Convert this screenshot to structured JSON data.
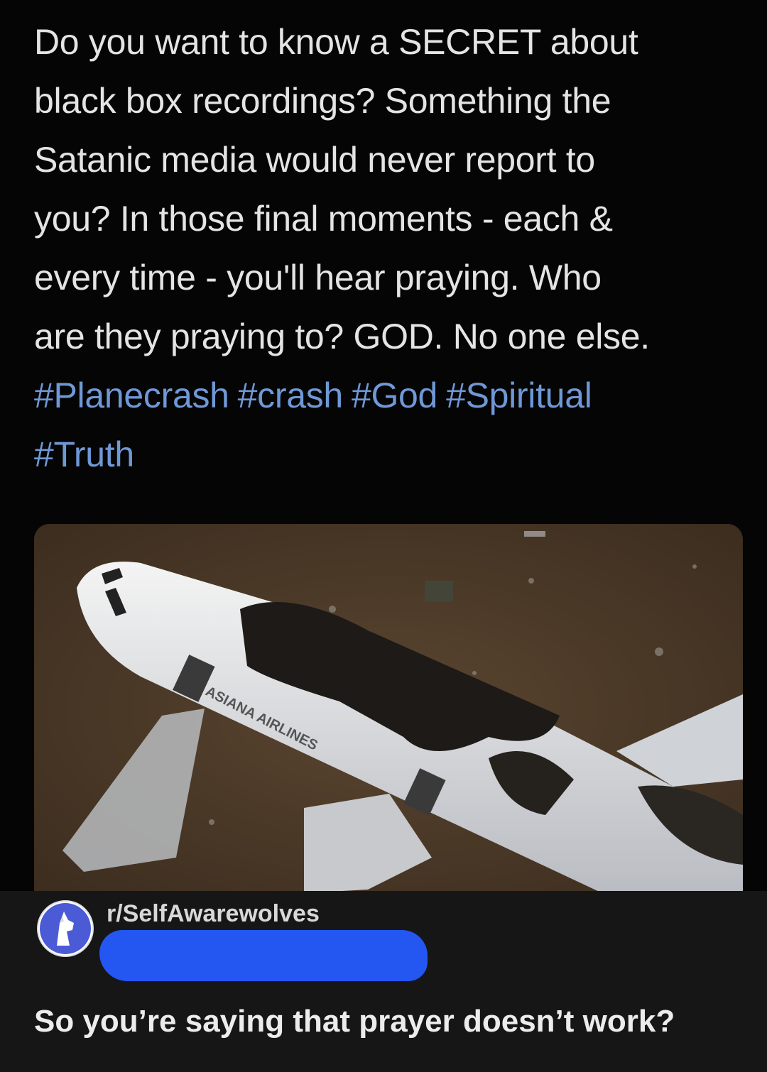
{
  "post": {
    "text_lines": [
      "Do you want to know a SECRET about",
      "black box recordings? Something the",
      "Satanic media would never report to",
      "you? In those final moments - each &",
      "every time - you'll hear praying. Who",
      "are they praying to? GOD. No one else."
    ],
    "hashtags": [
      "#Planecrash",
      "#crash",
      "#God",
      "#Spiritual",
      "#Truth"
    ],
    "image_text": "ASIANA AIRLINES"
  },
  "comment": {
    "subreddit": "r/SelfAwarewolves",
    "text": "So you’re saying that prayer doesn’t work?"
  },
  "colors": {
    "background": "#050505",
    "hashtag": "#6f98d6",
    "redaction": "#2456f2",
    "comment_background": "#161616"
  }
}
